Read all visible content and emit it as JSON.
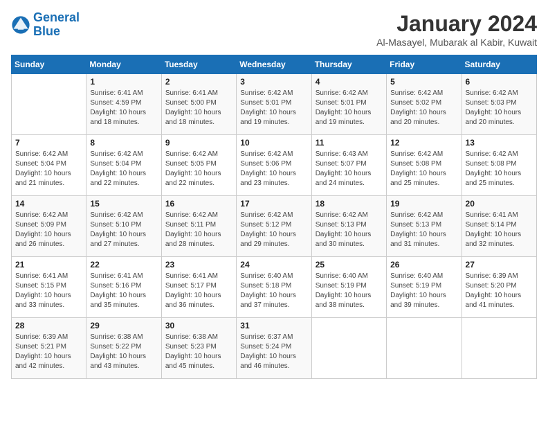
{
  "header": {
    "logo_line1": "General",
    "logo_line2": "Blue",
    "month": "January 2024",
    "location": "Al-Masayel, Mubarak al Kabir, Kuwait"
  },
  "weekdays": [
    "Sunday",
    "Monday",
    "Tuesday",
    "Wednesday",
    "Thursday",
    "Friday",
    "Saturday"
  ],
  "weeks": [
    [
      {
        "day": "",
        "sunrise": "",
        "sunset": "",
        "daylight": ""
      },
      {
        "day": "1",
        "sunrise": "Sunrise: 6:41 AM",
        "sunset": "Sunset: 4:59 PM",
        "daylight": "Daylight: 10 hours and 18 minutes."
      },
      {
        "day": "2",
        "sunrise": "Sunrise: 6:41 AM",
        "sunset": "Sunset: 5:00 PM",
        "daylight": "Daylight: 10 hours and 18 minutes."
      },
      {
        "day": "3",
        "sunrise": "Sunrise: 6:42 AM",
        "sunset": "Sunset: 5:01 PM",
        "daylight": "Daylight: 10 hours and 19 minutes."
      },
      {
        "day": "4",
        "sunrise": "Sunrise: 6:42 AM",
        "sunset": "Sunset: 5:01 PM",
        "daylight": "Daylight: 10 hours and 19 minutes."
      },
      {
        "day": "5",
        "sunrise": "Sunrise: 6:42 AM",
        "sunset": "Sunset: 5:02 PM",
        "daylight": "Daylight: 10 hours and 20 minutes."
      },
      {
        "day": "6",
        "sunrise": "Sunrise: 6:42 AM",
        "sunset": "Sunset: 5:03 PM",
        "daylight": "Daylight: 10 hours and 20 minutes."
      }
    ],
    [
      {
        "day": "7",
        "sunrise": "Sunrise: 6:42 AM",
        "sunset": "Sunset: 5:04 PM",
        "daylight": "Daylight: 10 hours and 21 minutes."
      },
      {
        "day": "8",
        "sunrise": "Sunrise: 6:42 AM",
        "sunset": "Sunset: 5:04 PM",
        "daylight": "Daylight: 10 hours and 22 minutes."
      },
      {
        "day": "9",
        "sunrise": "Sunrise: 6:42 AM",
        "sunset": "Sunset: 5:05 PM",
        "daylight": "Daylight: 10 hours and 22 minutes."
      },
      {
        "day": "10",
        "sunrise": "Sunrise: 6:42 AM",
        "sunset": "Sunset: 5:06 PM",
        "daylight": "Daylight: 10 hours and 23 minutes."
      },
      {
        "day": "11",
        "sunrise": "Sunrise: 6:43 AM",
        "sunset": "Sunset: 5:07 PM",
        "daylight": "Daylight: 10 hours and 24 minutes."
      },
      {
        "day": "12",
        "sunrise": "Sunrise: 6:42 AM",
        "sunset": "Sunset: 5:08 PM",
        "daylight": "Daylight: 10 hours and 25 minutes."
      },
      {
        "day": "13",
        "sunrise": "Sunrise: 6:42 AM",
        "sunset": "Sunset: 5:08 PM",
        "daylight": "Daylight: 10 hours and 25 minutes."
      }
    ],
    [
      {
        "day": "14",
        "sunrise": "Sunrise: 6:42 AM",
        "sunset": "Sunset: 5:09 PM",
        "daylight": "Daylight: 10 hours and 26 minutes."
      },
      {
        "day": "15",
        "sunrise": "Sunrise: 6:42 AM",
        "sunset": "Sunset: 5:10 PM",
        "daylight": "Daylight: 10 hours and 27 minutes."
      },
      {
        "day": "16",
        "sunrise": "Sunrise: 6:42 AM",
        "sunset": "Sunset: 5:11 PM",
        "daylight": "Daylight: 10 hours and 28 minutes."
      },
      {
        "day": "17",
        "sunrise": "Sunrise: 6:42 AM",
        "sunset": "Sunset: 5:12 PM",
        "daylight": "Daylight: 10 hours and 29 minutes."
      },
      {
        "day": "18",
        "sunrise": "Sunrise: 6:42 AM",
        "sunset": "Sunset: 5:13 PM",
        "daylight": "Daylight: 10 hours and 30 minutes."
      },
      {
        "day": "19",
        "sunrise": "Sunrise: 6:42 AM",
        "sunset": "Sunset: 5:13 PM",
        "daylight": "Daylight: 10 hours and 31 minutes."
      },
      {
        "day": "20",
        "sunrise": "Sunrise: 6:41 AM",
        "sunset": "Sunset: 5:14 PM",
        "daylight": "Daylight: 10 hours and 32 minutes."
      }
    ],
    [
      {
        "day": "21",
        "sunrise": "Sunrise: 6:41 AM",
        "sunset": "Sunset: 5:15 PM",
        "daylight": "Daylight: 10 hours and 33 minutes."
      },
      {
        "day": "22",
        "sunrise": "Sunrise: 6:41 AM",
        "sunset": "Sunset: 5:16 PM",
        "daylight": "Daylight: 10 hours and 35 minutes."
      },
      {
        "day": "23",
        "sunrise": "Sunrise: 6:41 AM",
        "sunset": "Sunset: 5:17 PM",
        "daylight": "Daylight: 10 hours and 36 minutes."
      },
      {
        "day": "24",
        "sunrise": "Sunrise: 6:40 AM",
        "sunset": "Sunset: 5:18 PM",
        "daylight": "Daylight: 10 hours and 37 minutes."
      },
      {
        "day": "25",
        "sunrise": "Sunrise: 6:40 AM",
        "sunset": "Sunset: 5:19 PM",
        "daylight": "Daylight: 10 hours and 38 minutes."
      },
      {
        "day": "26",
        "sunrise": "Sunrise: 6:40 AM",
        "sunset": "Sunset: 5:19 PM",
        "daylight": "Daylight: 10 hours and 39 minutes."
      },
      {
        "day": "27",
        "sunrise": "Sunrise: 6:39 AM",
        "sunset": "Sunset: 5:20 PM",
        "daylight": "Daylight: 10 hours and 41 minutes."
      }
    ],
    [
      {
        "day": "28",
        "sunrise": "Sunrise: 6:39 AM",
        "sunset": "Sunset: 5:21 PM",
        "daylight": "Daylight: 10 hours and 42 minutes."
      },
      {
        "day": "29",
        "sunrise": "Sunrise: 6:38 AM",
        "sunset": "Sunset: 5:22 PM",
        "daylight": "Daylight: 10 hours and 43 minutes."
      },
      {
        "day": "30",
        "sunrise": "Sunrise: 6:38 AM",
        "sunset": "Sunset: 5:23 PM",
        "daylight": "Daylight: 10 hours and 45 minutes."
      },
      {
        "day": "31",
        "sunrise": "Sunrise: 6:37 AM",
        "sunset": "Sunset: 5:24 PM",
        "daylight": "Daylight: 10 hours and 46 minutes."
      },
      {
        "day": "",
        "sunrise": "",
        "sunset": "",
        "daylight": ""
      },
      {
        "day": "",
        "sunrise": "",
        "sunset": "",
        "daylight": ""
      },
      {
        "day": "",
        "sunrise": "",
        "sunset": "",
        "daylight": ""
      }
    ]
  ]
}
